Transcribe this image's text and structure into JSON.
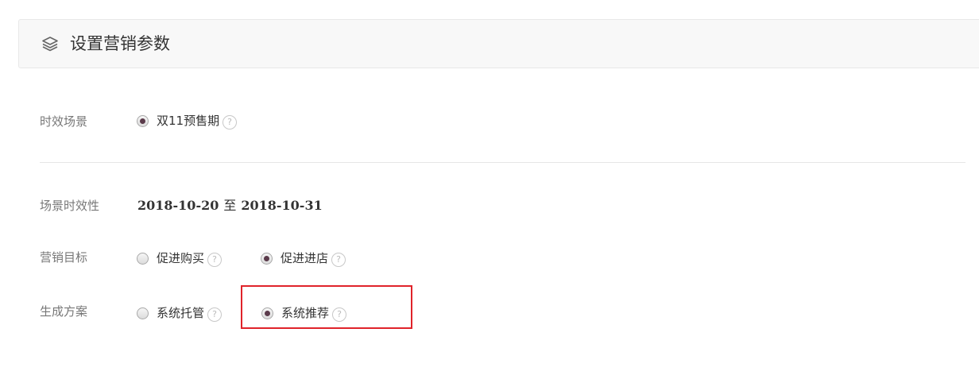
{
  "header": {
    "title": "设置营销参数",
    "icon": "layers-icon"
  },
  "scene": {
    "label": "时效场景",
    "options": [
      {
        "label": "双11预售期",
        "checked": true
      }
    ]
  },
  "timing": {
    "label": "场景时效性",
    "start": "2018-10-20",
    "separator": "至",
    "end": "2018-10-31"
  },
  "goal": {
    "label": "营销目标",
    "options": [
      {
        "label": "促进购买",
        "checked": false
      },
      {
        "label": "促进进店",
        "checked": true
      }
    ]
  },
  "plan": {
    "label": "生成方案",
    "options": [
      {
        "label": "系统托管",
        "checked": false
      },
      {
        "label": "系统推荐",
        "checked": true
      }
    ]
  },
  "help_glyph": "?",
  "colors": {
    "highlight": "#e0232a",
    "radio_dot": "#5b3b4b"
  }
}
